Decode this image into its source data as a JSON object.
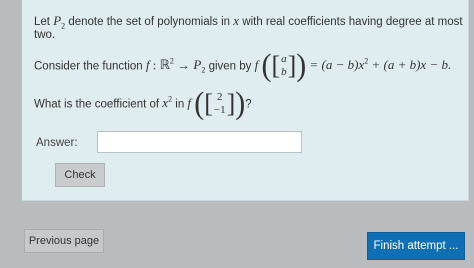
{
  "question": {
    "line1_prefix": "Let ",
    "line1_P": "P",
    "line1_sub": "2",
    "line1_mid": " denote the set of polynomials in ",
    "line1_x": "x",
    "line1_suffix": " with real coefficients having degree at most",
    "line2": "two.",
    "line3_prefix": "Consider the function ",
    "line3_f": "f",
    "line3_colon": " : ",
    "line3_R": "ℝ",
    "line3_Rexp": "2",
    "line3_arrow": " → ",
    "line3_P": "P",
    "line3_Psub": "2",
    "line3_given": " given by ",
    "line3_f2": "f",
    "line3_vec_top": "a",
    "line3_vec_bottom": "b",
    "line3_rhs": " = (a − b)x",
    "line3_rhs_exp": "2",
    "line3_rhs_tail": " + (a + b)x − b.",
    "line4_prefix": "What is the coefficient of ",
    "line4_x": "x",
    "line4_exp": "2",
    "line4_in": " in ",
    "line4_f": "f",
    "line4_vec_top": "2",
    "line4_vec_bottom": "−1",
    "line4_q": "?"
  },
  "answer": {
    "label": "Answer:",
    "value": "",
    "placeholder": ""
  },
  "buttons": {
    "check": "Check",
    "previous": "Previous page",
    "finish": "Finish attempt ..."
  }
}
